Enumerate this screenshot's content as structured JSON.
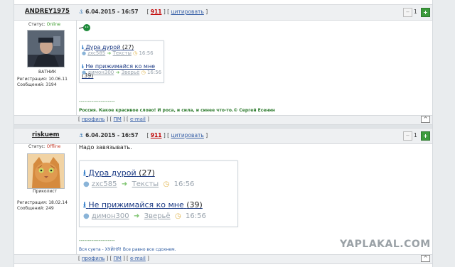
{
  "posts": [
    {
      "author": "ANDREY1975",
      "date": "6.04.2015 - 16:57",
      "post_number": "911",
      "cite_label": "цитировать",
      "status_label": "Статус:",
      "status": "Online",
      "avatar_caption": "ВАТНИК",
      "reg_label": "Регистрация:",
      "reg_date": "10.06.11",
      "msgs_label": "Сообщений:",
      "msgs": "3194",
      "vote_count": "1",
      "card_items": [
        {
          "title": "Дура дурой",
          "count": "(27)",
          "user": "zxc585",
          "section": "Тексты",
          "time": "16:56"
        },
        {
          "title": "Не прижимайся ко мне",
          "count": "(39)",
          "user": "димон300",
          "section": "Зверьё",
          "time": "16:56"
        }
      ],
      "signature_dashes": "--------------------",
      "signature": "Россия. Какое красивое слово! И роса, и сила, и синее что-то.© Сергей Есенин",
      "footer": {
        "profile": "профиль",
        "pm": "ПМ",
        "email": "e-mail"
      }
    },
    {
      "author": "riskuem",
      "date": "6.04.2015 - 16:57",
      "post_number": "911",
      "cite_label": "цитировать",
      "status_label": "Статус:",
      "status": "Offline",
      "avatar_caption": "Приколист",
      "reg_label": "Регистрация:",
      "reg_date": "18.02.14",
      "msgs_label": "Сообщений:",
      "msgs": "249",
      "vote_count": "1",
      "text": "Надо завязывать.",
      "card_items": [
        {
          "title": "Дура дурой",
          "count": "(27)",
          "user": "zxc585",
          "section": "Тексты",
          "time": "16:56"
        },
        {
          "title": "Не прижимайся ко мне",
          "count": "(39)",
          "user": "димон300",
          "section": "Зверьё",
          "time": "16:56"
        }
      ],
      "signature_dashes": "--------------------",
      "signature": "Вся суета - ХУЙНЯ! Все равно все сдохнем.",
      "footer": {
        "profile": "профиль",
        "pm": "ПМ",
        "email": "e-mail"
      }
    }
  ],
  "watermark": "YAPLAKAL.COM",
  "colors": {
    "accent": "#1b3a84",
    "online": "#3a9b2a",
    "offline": "#c43a2a",
    "post_number": "#c00000",
    "signature": "#2c7a2c"
  },
  "icons": [
    "anchor-icon",
    "thumbs-down-icon",
    "thumbs-up-icon",
    "download-arrow-icon",
    "user-icon",
    "right-arrow-icon",
    "clock-icon",
    "scroll-up-icon"
  ]
}
